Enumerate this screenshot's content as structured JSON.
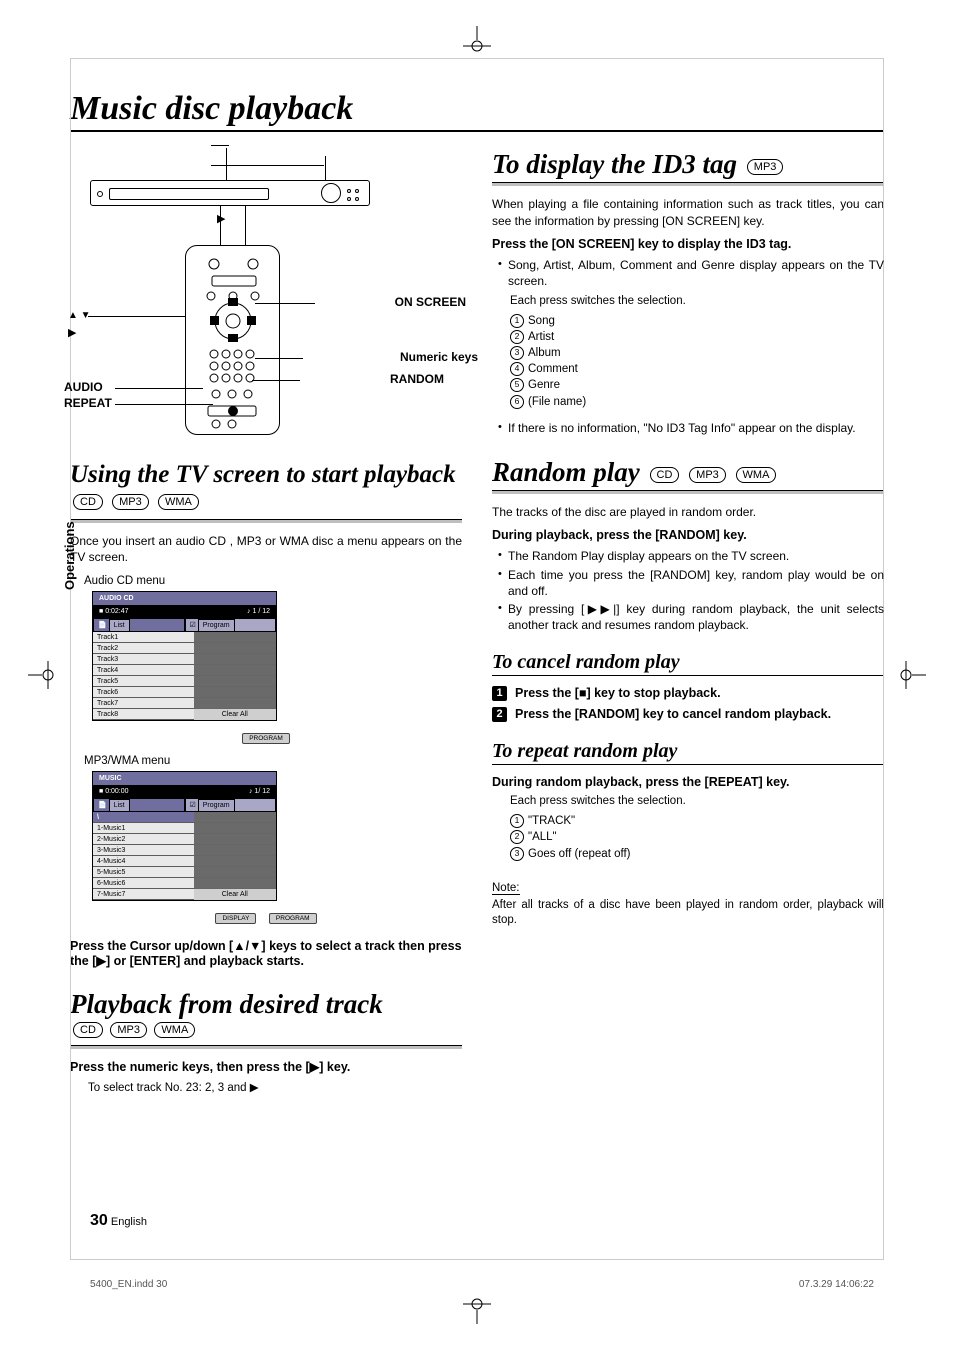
{
  "page_title": "Music disc playback",
  "side_tab": "Operations",
  "diagram_labels": {
    "on_screen": "ON SCREEN",
    "numeric_keys": "Numeric keys",
    "random": "RANDOM",
    "audio": "AUDIO",
    "repeat": "REPEAT"
  },
  "left": {
    "sec1_title": "Using the TV screen to start playback",
    "sec1_tags": [
      "CD",
      "MP3",
      "WMA"
    ],
    "sec1_intro": "Once you insert an audio CD , MP3 or WMA disc a menu appears on the TV screen.",
    "cap_cd": "Audio CD menu",
    "cap_mp3": "MP3/WMA menu",
    "cursor_instr": "Press the Cursor up/down [▲/▼] keys to select a track then press the [▶] or [ENTER] and playback starts.",
    "sec2_title": "Playback from desired track",
    "sec2_tags": [
      "CD",
      "MP3",
      "WMA"
    ],
    "sec2_bold": "Press the numeric keys, then press the [▶] key.",
    "sec2_example": "To select track No. 23: 2, 3 and ▶"
  },
  "osd_cd": {
    "title": "AUDIO CD",
    "time": "0:02:47",
    "pos": "1 / 12",
    "tab_list": "List",
    "tab_prog": "Program",
    "tracks": [
      "Track1",
      "Track2",
      "Track3",
      "Track4",
      "Track5",
      "Track6",
      "Track7",
      "Track8"
    ],
    "clear": "Clear All",
    "btn": "PROGRAM"
  },
  "osd_mp3": {
    "title": "MUSIC",
    "time": "0:00:00",
    "pos": "1/ 12",
    "tab_list": "List",
    "tab_prog": "Program",
    "folder": "\\",
    "tracks": [
      "1-Music1",
      "2-Music2",
      "3-Music3",
      "4-Music4",
      "5-Music5",
      "6-Music6",
      "7-Music7"
    ],
    "clear": "Clear All",
    "btn1": "DISPLAY",
    "btn2": "PROGRAM"
  },
  "right": {
    "id3_title": "To display the ID3 tag",
    "id3_tags": [
      "MP3"
    ],
    "id3_intro": "When playing a file containing information such as track titles, you can see the information by pressing [ON SCREEN] key.",
    "id3_bold": "Press the [ON SCREEN] key to display the ID3 tag.",
    "id3_bul1": "Song, Artist, Album, Comment and Genre display appears on the TV screen.",
    "id3_switch": "Each press switches the selection.",
    "id3_list": [
      "Song",
      "Artist",
      "Album",
      "Comment",
      "Genre",
      "(File name)"
    ],
    "id3_bul2": "If there is no information, \"No ID3 Tag Info\" appear on the display.",
    "rnd_title": "Random play",
    "rnd_tags": [
      "CD",
      "MP3",
      "WMA"
    ],
    "rnd_intro": "The tracks of the disc are played in random order.",
    "rnd_bold": "During playback, press the [RANDOM] key.",
    "rnd_buls": [
      "The Random Play display appears on the TV screen.",
      "Each time you press the [RANDOM] key, random play would be on and off.",
      "By pressing [▶▶|] key during random playback, the unit selects another track and resumes random playback."
    ],
    "cancel_title": "To cancel random play",
    "step1": "Press the [■] key to stop playback.",
    "step2": "Press the [RANDOM] key to cancel random playback.",
    "repeat_title": "To repeat random play",
    "repeat_bold": "During random playback, press the [REPEAT] key.",
    "repeat_switch": "Each press switches the selection.",
    "repeat_list": [
      "\"TRACK\"",
      "\"ALL\"",
      "Goes off (repeat off)"
    ],
    "note_label": "Note:",
    "note_body": "After all tracks of a disc have been played in random order, playback will stop."
  },
  "footer": {
    "page_no": "30",
    "lang": "English",
    "fileline": "5400_EN.indd   30",
    "stamp": "07.3.29   14:06:22"
  }
}
